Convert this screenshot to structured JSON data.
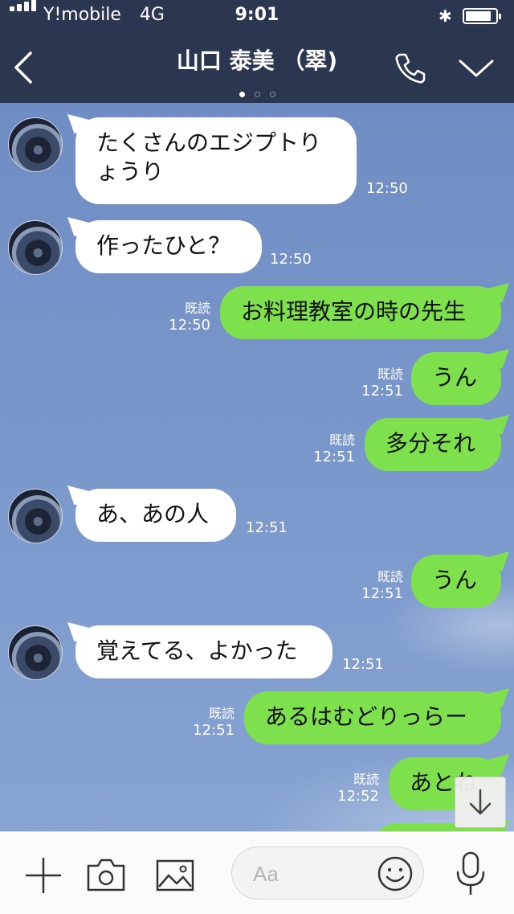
{
  "status_bar": {
    "carrier": "Y!mobile",
    "network": "4G",
    "time": "9:01",
    "battery_level": 0.85
  },
  "header": {
    "title": "山口 泰美 （翠)",
    "page_dots": 3,
    "active_dot": 0
  },
  "messages": [
    {
      "side": "in",
      "lines": [
        "たくさんのエジプトり",
        "ょうり"
      ],
      "time": "12:50"
    },
    {
      "side": "in",
      "lines": [
        "作ったひと？"
      ],
      "time": "12:50"
    },
    {
      "side": "out",
      "lines": [
        "お料理教室の時の先生"
      ],
      "read": "既読",
      "time": "12:50"
    },
    {
      "side": "out",
      "lines": [
        "うん"
      ],
      "read": "既読",
      "time": "12:51"
    },
    {
      "side": "out",
      "lines": [
        "多分それ"
      ],
      "read": "既読",
      "time": "12:51"
    },
    {
      "side": "in",
      "lines": [
        "あ、あの人"
      ],
      "time": "12:51"
    },
    {
      "side": "out",
      "lines": [
        "うん"
      ],
      "read": "既読",
      "time": "12:51"
    },
    {
      "side": "in",
      "lines": [
        "覚えてる、よかった"
      ],
      "time": "12:51"
    },
    {
      "side": "out",
      "lines": [
        "あるはむどりっらー"
      ],
      "read": "既読",
      "time": "12:51"
    },
    {
      "side": "out",
      "lines": [
        "あとね"
      ],
      "read": "既読",
      "time": "12:52"
    }
  ],
  "input": {
    "placeholder": "Aa"
  },
  "icons": {
    "back": "chevron-left-icon",
    "call": "phone-icon",
    "menu": "chevron-down-icon",
    "add": "plus-icon",
    "camera": "camera-icon",
    "image": "image-icon",
    "emoji": "smiley-icon",
    "mic": "microphone-icon",
    "scroll": "arrow-down-icon"
  },
  "colors": {
    "header_bg": "#2b3650",
    "chat_bg": "#7b93c4",
    "out_bubble": "#7fe04d",
    "in_bubble": "#ffffff"
  }
}
